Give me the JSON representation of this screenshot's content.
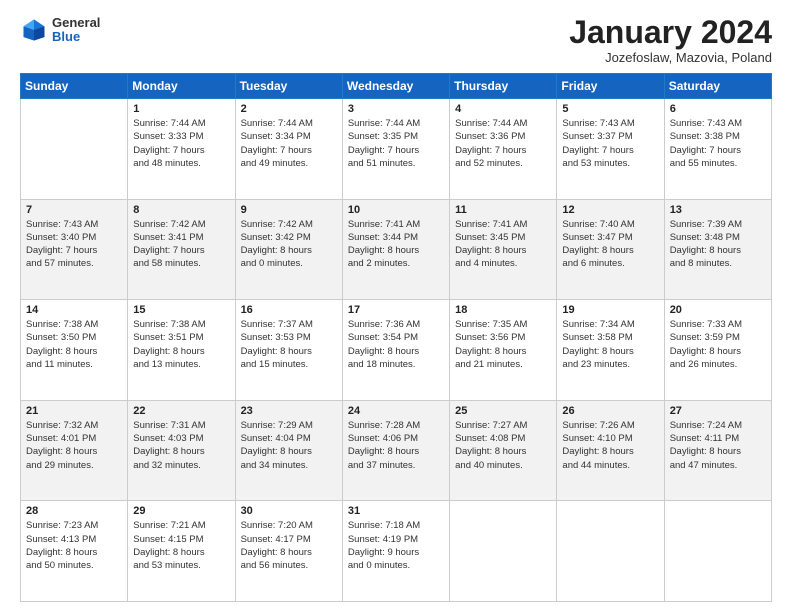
{
  "title": "January 2024",
  "subtitle": "Jozefoslaw, Mazovia, Poland",
  "logo": {
    "line1": "General",
    "line2": "Blue"
  },
  "days_of_week": [
    "Sunday",
    "Monday",
    "Tuesday",
    "Wednesday",
    "Thursday",
    "Friday",
    "Saturday"
  ],
  "weeks": [
    [
      {
        "num": "",
        "info": ""
      },
      {
        "num": "1",
        "info": "Sunrise: 7:44 AM\nSunset: 3:33 PM\nDaylight: 7 hours\nand 48 minutes."
      },
      {
        "num": "2",
        "info": "Sunrise: 7:44 AM\nSunset: 3:34 PM\nDaylight: 7 hours\nand 49 minutes."
      },
      {
        "num": "3",
        "info": "Sunrise: 7:44 AM\nSunset: 3:35 PM\nDaylight: 7 hours\nand 51 minutes."
      },
      {
        "num": "4",
        "info": "Sunrise: 7:44 AM\nSunset: 3:36 PM\nDaylight: 7 hours\nand 52 minutes."
      },
      {
        "num": "5",
        "info": "Sunrise: 7:43 AM\nSunset: 3:37 PM\nDaylight: 7 hours\nand 53 minutes."
      },
      {
        "num": "6",
        "info": "Sunrise: 7:43 AM\nSunset: 3:38 PM\nDaylight: 7 hours\nand 55 minutes."
      }
    ],
    [
      {
        "num": "7",
        "info": "Sunrise: 7:43 AM\nSunset: 3:40 PM\nDaylight: 7 hours\nand 57 minutes."
      },
      {
        "num": "8",
        "info": "Sunrise: 7:42 AM\nSunset: 3:41 PM\nDaylight: 7 hours\nand 58 minutes."
      },
      {
        "num": "9",
        "info": "Sunrise: 7:42 AM\nSunset: 3:42 PM\nDaylight: 8 hours\nand 0 minutes."
      },
      {
        "num": "10",
        "info": "Sunrise: 7:41 AM\nSunset: 3:44 PM\nDaylight: 8 hours\nand 2 minutes."
      },
      {
        "num": "11",
        "info": "Sunrise: 7:41 AM\nSunset: 3:45 PM\nDaylight: 8 hours\nand 4 minutes."
      },
      {
        "num": "12",
        "info": "Sunrise: 7:40 AM\nSunset: 3:47 PM\nDaylight: 8 hours\nand 6 minutes."
      },
      {
        "num": "13",
        "info": "Sunrise: 7:39 AM\nSunset: 3:48 PM\nDaylight: 8 hours\nand 8 minutes."
      }
    ],
    [
      {
        "num": "14",
        "info": "Sunrise: 7:38 AM\nSunset: 3:50 PM\nDaylight: 8 hours\nand 11 minutes."
      },
      {
        "num": "15",
        "info": "Sunrise: 7:38 AM\nSunset: 3:51 PM\nDaylight: 8 hours\nand 13 minutes."
      },
      {
        "num": "16",
        "info": "Sunrise: 7:37 AM\nSunset: 3:53 PM\nDaylight: 8 hours\nand 15 minutes."
      },
      {
        "num": "17",
        "info": "Sunrise: 7:36 AM\nSunset: 3:54 PM\nDaylight: 8 hours\nand 18 minutes."
      },
      {
        "num": "18",
        "info": "Sunrise: 7:35 AM\nSunset: 3:56 PM\nDaylight: 8 hours\nand 21 minutes."
      },
      {
        "num": "19",
        "info": "Sunrise: 7:34 AM\nSunset: 3:58 PM\nDaylight: 8 hours\nand 23 minutes."
      },
      {
        "num": "20",
        "info": "Sunrise: 7:33 AM\nSunset: 3:59 PM\nDaylight: 8 hours\nand 26 minutes."
      }
    ],
    [
      {
        "num": "21",
        "info": "Sunrise: 7:32 AM\nSunset: 4:01 PM\nDaylight: 8 hours\nand 29 minutes."
      },
      {
        "num": "22",
        "info": "Sunrise: 7:31 AM\nSunset: 4:03 PM\nDaylight: 8 hours\nand 32 minutes."
      },
      {
        "num": "23",
        "info": "Sunrise: 7:29 AM\nSunset: 4:04 PM\nDaylight: 8 hours\nand 34 minutes."
      },
      {
        "num": "24",
        "info": "Sunrise: 7:28 AM\nSunset: 4:06 PM\nDaylight: 8 hours\nand 37 minutes."
      },
      {
        "num": "25",
        "info": "Sunrise: 7:27 AM\nSunset: 4:08 PM\nDaylight: 8 hours\nand 40 minutes."
      },
      {
        "num": "26",
        "info": "Sunrise: 7:26 AM\nSunset: 4:10 PM\nDaylight: 8 hours\nand 44 minutes."
      },
      {
        "num": "27",
        "info": "Sunrise: 7:24 AM\nSunset: 4:11 PM\nDaylight: 8 hours\nand 47 minutes."
      }
    ],
    [
      {
        "num": "28",
        "info": "Sunrise: 7:23 AM\nSunset: 4:13 PM\nDaylight: 8 hours\nand 50 minutes."
      },
      {
        "num": "29",
        "info": "Sunrise: 7:21 AM\nSunset: 4:15 PM\nDaylight: 8 hours\nand 53 minutes."
      },
      {
        "num": "30",
        "info": "Sunrise: 7:20 AM\nSunset: 4:17 PM\nDaylight: 8 hours\nand 56 minutes."
      },
      {
        "num": "31",
        "info": "Sunrise: 7:18 AM\nSunset: 4:19 PM\nDaylight: 9 hours\nand 0 minutes."
      },
      {
        "num": "",
        "info": ""
      },
      {
        "num": "",
        "info": ""
      },
      {
        "num": "",
        "info": ""
      }
    ]
  ]
}
